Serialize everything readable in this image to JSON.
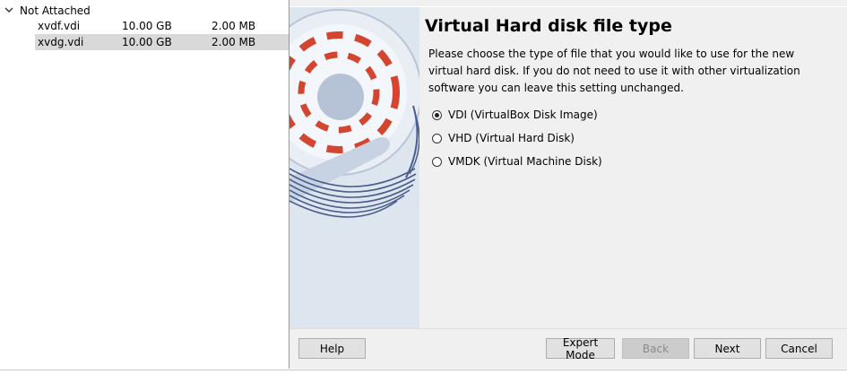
{
  "media_list": {
    "group_label": "Not Attached",
    "rows": [
      {
        "name": "xvdf.vdi",
        "virtual_size": "10.00 GB",
        "actual_size": "2.00 MB",
        "selected": false
      },
      {
        "name": "xvdg.vdi",
        "virtual_size": "10.00 GB",
        "actual_size": "2.00 MB",
        "selected": true
      }
    ]
  },
  "wizard": {
    "title": "Virtual Hard disk file type",
    "description": "Please choose the type of file that you would like to use for the new virtual hard disk. If you do not need to use it with other virtualization software you can leave this setting unchanged.",
    "options": [
      {
        "label": "VDI (VirtualBox Disk Image)",
        "checked": true
      },
      {
        "label": "VHD (Virtual Hard Disk)",
        "checked": false
      },
      {
        "label": "VMDK (Virtual Machine Disk)",
        "checked": false
      }
    ],
    "buttons": {
      "help": "Help",
      "expert_mode": "Expert Mode",
      "back": "Back",
      "next": "Next",
      "cancel": "Cancel"
    }
  },
  "colors": {
    "watermark_bg": "#dde5ef",
    "disk_stripe_red": "#d4452f",
    "disk_blue": "#4a5d8a",
    "selected_row": "#d9d9d9"
  },
  "icons": {
    "tree_expand": "chevron-down-icon",
    "watermark": "hard-disk-icon"
  }
}
